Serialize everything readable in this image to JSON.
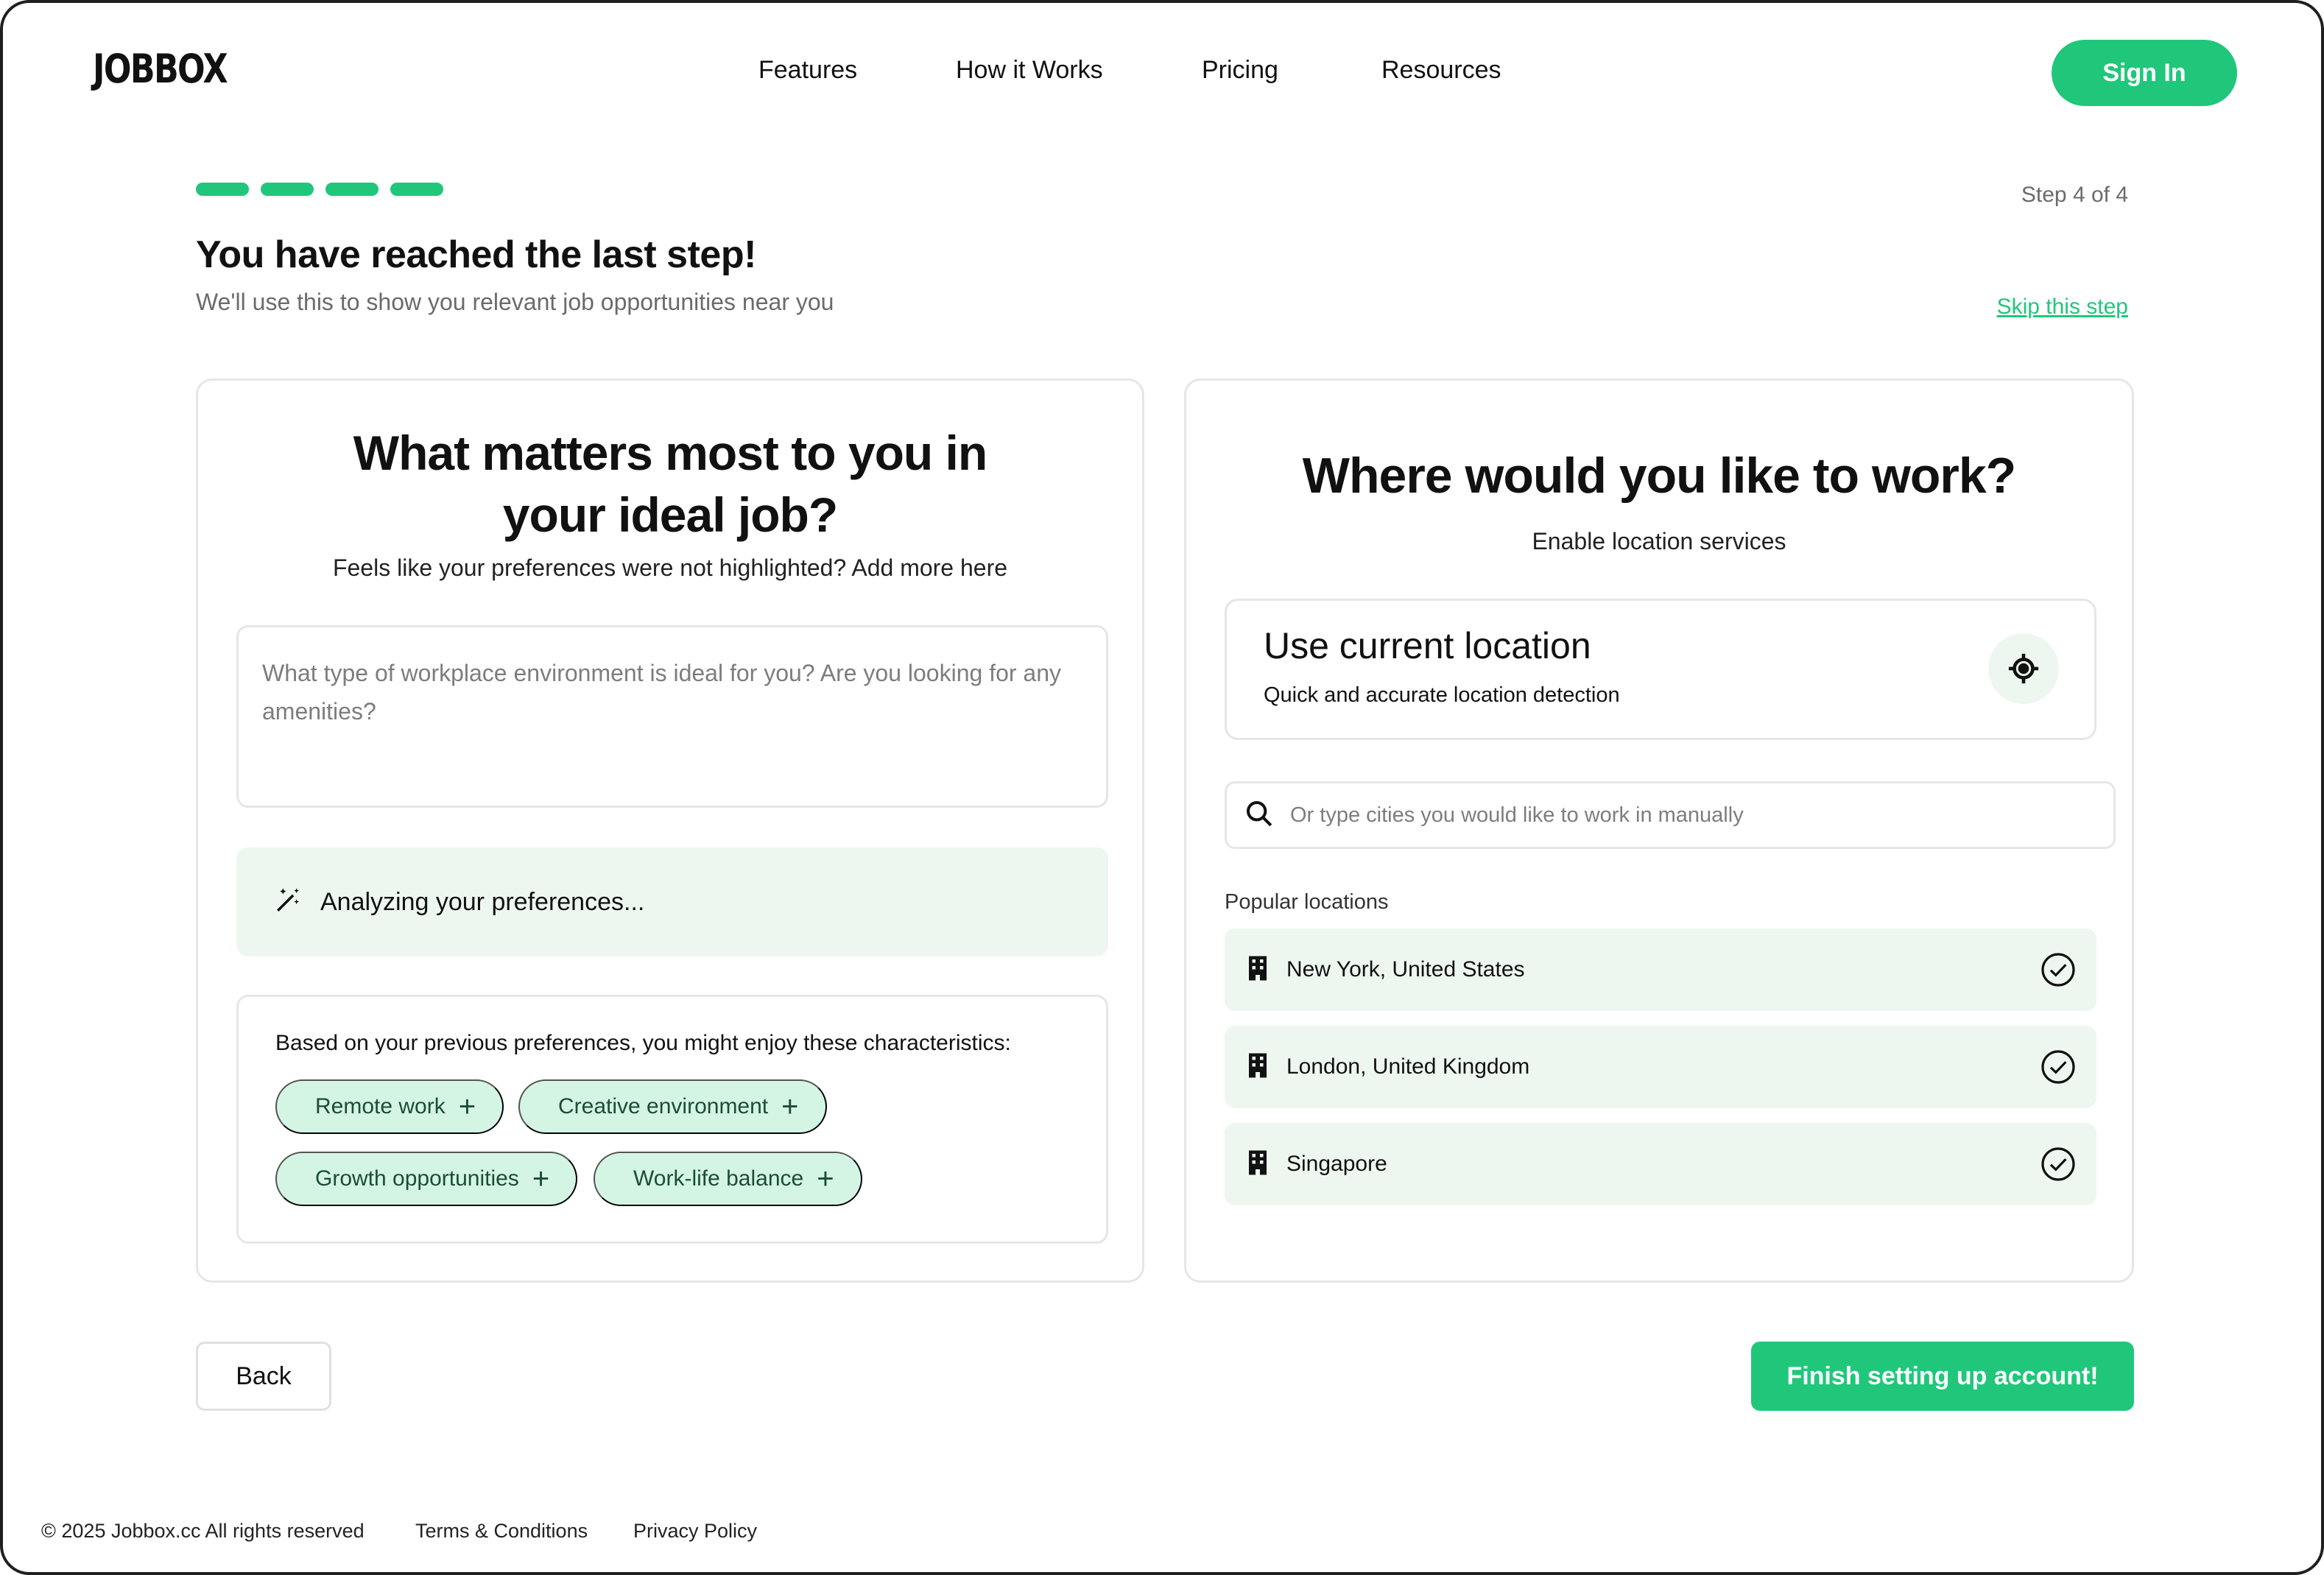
{
  "header": {
    "logo": "JOBBOX",
    "nav": [
      "Features",
      "How it Works",
      "Pricing",
      "Resources"
    ],
    "sign_in": "Sign In"
  },
  "progress": {
    "current_step": 4,
    "total_steps": 4,
    "label": "Step 4 of 4"
  },
  "intro": {
    "title": "You have reached the last step!",
    "subtitle": "We'll use this to show you relevant job opportunities near you",
    "skip": "Skip this step"
  },
  "preferences": {
    "question_line1": "What matters most to you in",
    "question_line2": "your ideal job?",
    "hint": "Feels like your preferences were not highlighted? Add more here",
    "textarea_placeholder": "What type of workplace environment is ideal for you? Are you looking for any amenities?",
    "analyzing": "Analyzing your preferences...",
    "suggestions_heading": "Based on your previous preferences, you might enjoy these characteristics:",
    "chips": [
      "Remote work",
      "Creative environment",
      "Growth opportunities",
      "Work-life balance"
    ]
  },
  "location": {
    "question": "Where would you like to work?",
    "subtitle": "Enable location services",
    "current_title": "Use current location",
    "current_subtitle": "Quick and accurate location detection",
    "search_placeholder": "Or type cities you would like to work in manually",
    "popular_label": "Popular locations",
    "popular": [
      "New York, United States",
      "London, United Kingdom",
      "Singapore"
    ]
  },
  "actions": {
    "back": "Back",
    "finish": "Finish setting up account!"
  },
  "footer": {
    "copyright": "© 2025 Jobbox.cc All rights reserved",
    "terms": "Terms & Conditions",
    "privacy": "Privacy Policy"
  },
  "colors": {
    "accent": "#20c77a",
    "chip_bg": "#d5f5e4",
    "soft_bg": "#edf7f0"
  }
}
